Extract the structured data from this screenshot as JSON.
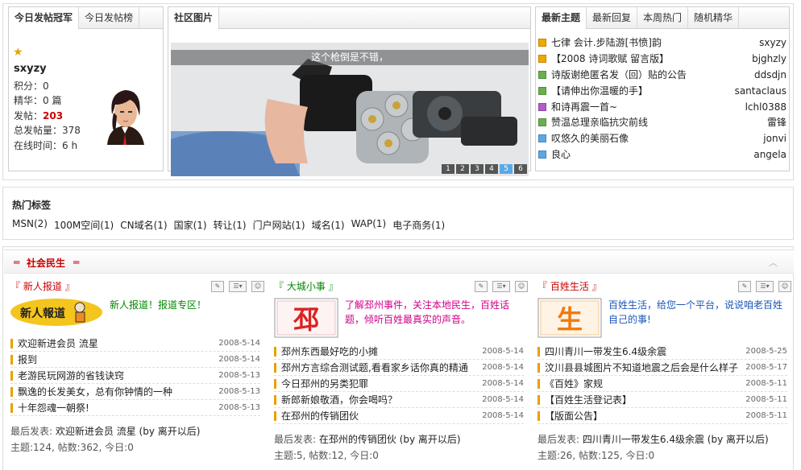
{
  "champion": {
    "tabs": [
      "今日发帖冠军",
      "今日发帖榜"
    ],
    "username": "sxyzy",
    "stats": [
      {
        "label": "积分：",
        "value": "0"
      },
      {
        "label": "精华：",
        "value": "0 篇"
      },
      {
        "label": "发帖：",
        "value": "203"
      },
      {
        "label": "总发帖量：",
        "value": "378"
      },
      {
        "label": "在线时间：",
        "value": "6 h"
      }
    ]
  },
  "photos": {
    "tab": "社区图片",
    "caption": "这个枪倒是不错，",
    "pages": [
      "1",
      "2",
      "3",
      "4",
      "5",
      "6"
    ],
    "active_page": "5"
  },
  "topics": {
    "tabs": [
      "最新主题",
      "最新回复",
      "本周热门",
      "随机精华"
    ],
    "items": [
      {
        "title": "七律  会计.步陆游[书愤]韵",
        "author": "sxyzy",
        "color": "#f0a800"
      },
      {
        "title": "【2008 诗词歌赋 留言版】",
        "author": "bjghzly",
        "color": "#f0a800"
      },
      {
        "title": "诗版谢绝匿名发（回）贴的公告",
        "author": "ddsdjn",
        "color": "#6ab04c"
      },
      {
        "title": "【请伸出你温暖的手】",
        "author": "santaclaus",
        "color": "#6ab04c"
      },
      {
        "title": "和诗再震一首~",
        "author": "lchl0388",
        "color": "#b05cc6"
      },
      {
        "title": "赞温总理亲临抗灾前线",
        "author": "雷锋",
        "color": "#6ab04c"
      },
      {
        "title": "叹悠久的美丽石像",
        "author": "jonvi",
        "color": "#5aa9e6"
      },
      {
        "title": "良心",
        "author": "angela",
        "color": "#5aa9e6"
      }
    ]
  },
  "hot_tags": {
    "title": "热门标签",
    "tags": [
      "MSN(2)",
      "100M空间(1)",
      "CN域名(1)",
      "国家(1)",
      "转让(1)",
      "门户网站(1)",
      "域名(1)",
      "WAP(1)",
      "电子商务(1)"
    ]
  },
  "section": {
    "title": "社会民生"
  },
  "columns": [
    {
      "title": "新人报道",
      "logo_text": "新人報道",
      "desc": "新人报道！报道专区！",
      "posts": [
        {
          "title": "欢迎新进会员 流星",
          "date": "2008-5-14"
        },
        {
          "title": "报到",
          "date": "2008-5-14"
        },
        {
          "title": "老游民玩网游的省钱诀窍",
          "date": "2008-5-13"
        },
        {
          "title": "飘逸的长发美女，总有你钟情的一种",
          "date": "2008-5-13"
        },
        {
          "title": "十年怨魂一朝祭!",
          "date": "2008-5-13"
        }
      ],
      "last_label": "最后发表:",
      "last_post": "欢迎新进会员 流星",
      "last_by": "(by 离开以后)",
      "stats": "主题:124, 帖数:362, 今日:0"
    },
    {
      "title": "大城小事",
      "logo_text": "邳",
      "desc": "了解邳州事件，关注本地民生，百姓话题，倾听百姓最真实的声音。",
      "posts": [
        {
          "title": "邳州东西最好吃的小摊",
          "date": "2008-5-14"
        },
        {
          "title": "邳州方言综合测试题,看看家乡话你真的精通",
          "date": "2008-5-14"
        },
        {
          "title": "今日邳州的另类犯罪",
          "date": "2008-5-14"
        },
        {
          "title": "新郎新娘敬酒，你会喝吗？",
          "date": "2008-5-14"
        },
        {
          "title": "在邳州的传销团伙",
          "date": "2008-5-14"
        }
      ],
      "last_label": "最后发表:",
      "last_post": "在邳州的传销团伙",
      "last_by": "(by 离开以后)",
      "stats": "主题:5, 帖数:12, 今日:0"
    },
    {
      "title": "百姓生活",
      "logo_text": "生",
      "desc": "百姓生活，给您一个平台，说说咱老百姓自己的事!",
      "posts": [
        {
          "title": "四川青川一带发生6.4级余震",
          "date": "2008-5-25"
        },
        {
          "title": "汶川县县城图片不知道地震之后会是什么样子",
          "date": "2008-5-17"
        },
        {
          "title": "《百姓》家规",
          "date": "2008-5-11"
        },
        {
          "title": "【百姓生活登记表】",
          "date": "2008-5-11"
        },
        {
          "title": "【版面公告】",
          "date": "2008-5-11"
        }
      ],
      "last_label": "最后发表:",
      "last_post": "四川青川一带发生6.4级余震",
      "last_by": "(by 离开以后)",
      "stats": "主题:26, 帖数:125, 今日:0"
    }
  ]
}
